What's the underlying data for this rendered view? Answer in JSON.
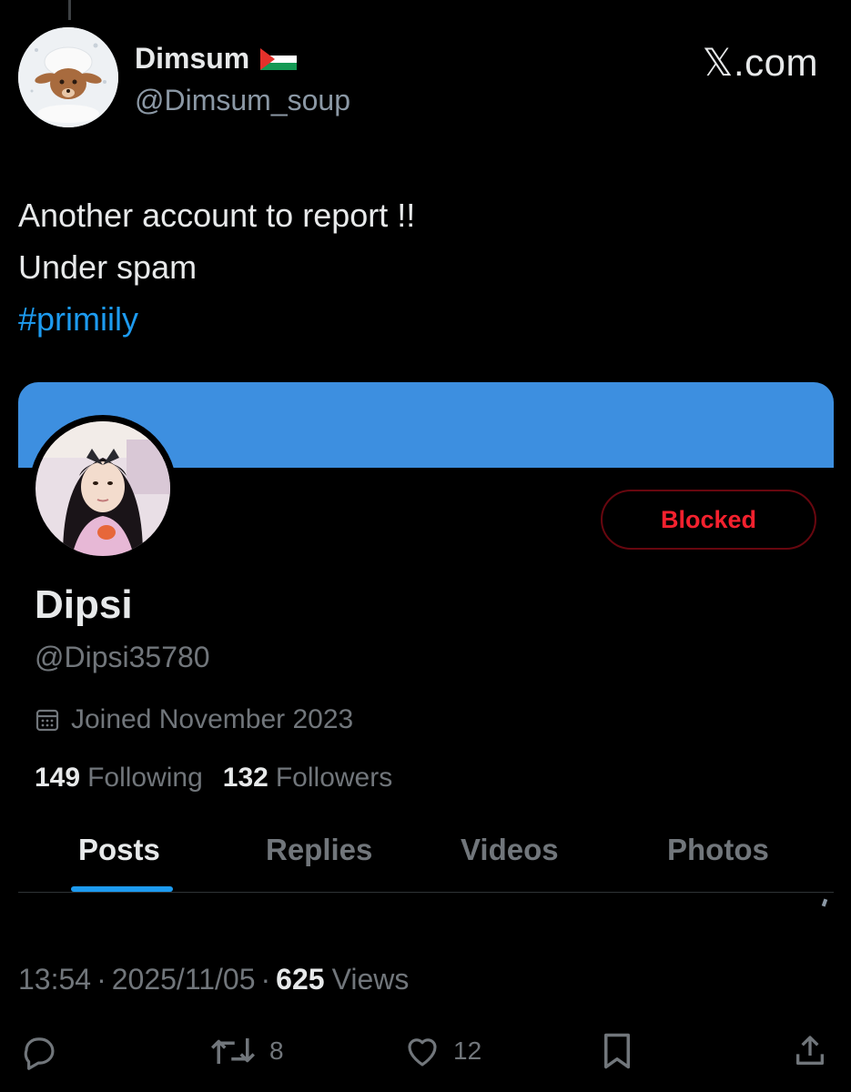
{
  "tweet": {
    "author_name": "Dimsum",
    "author_flag": "palestine-flag",
    "author_handle": "@Dimsum_soup",
    "brand": "𝕏.com",
    "text_line1": "Another account to report !!",
    "text_line2": "Under spam",
    "hashtag": "#primiily",
    "time": "13:54",
    "date": "2025/11/05",
    "views_count": "625",
    "views_label": "Views",
    "separator": "·"
  },
  "profile": {
    "banner_color": "#3d8fe0",
    "name": "Dipsi",
    "handle": "@Dipsi35780",
    "blocked_label": "Blocked",
    "joined": "Joined November 2023",
    "following_count": "149",
    "following_label": "Following",
    "followers_count": "132",
    "followers_label": "Followers",
    "tabs": [
      {
        "label": "Posts",
        "active": true
      },
      {
        "label": "Replies",
        "active": false
      },
      {
        "label": "Videos",
        "active": false
      },
      {
        "label": "Photos",
        "active": false
      }
    ]
  },
  "actions": {
    "reply_count": "",
    "retweet_count": "8",
    "like_count": "12"
  },
  "colors": {
    "accent": "#1d9bf0",
    "blocked": "#f4212e",
    "muted": "#71767b"
  }
}
